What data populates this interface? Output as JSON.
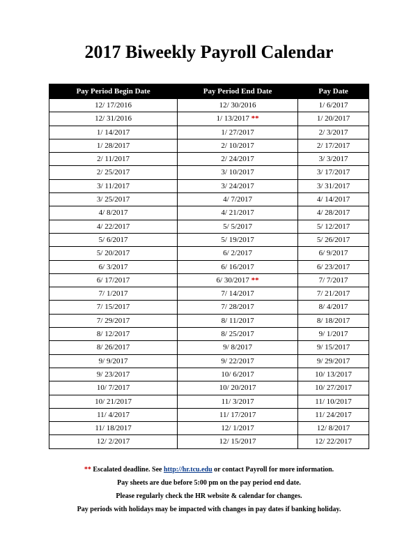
{
  "title": "2017 Biweekly Payroll Calendar",
  "headers": {
    "begin": "Pay Period Begin Date",
    "end": "Pay Period End Date",
    "pay": "Pay Date"
  },
  "rows": [
    {
      "begin": "12/ 17/2016",
      "end": "12/ 30/2016",
      "end_mark": "",
      "pay": "1/ 6/2017"
    },
    {
      "begin": "12/ 31/2016",
      "end": "1/ 13/2017",
      "end_mark": "**",
      "pay": "1/ 20/2017"
    },
    {
      "begin": "1/ 14/2017",
      "end": "1/ 27/2017",
      "end_mark": "",
      "pay": "2/ 3/2017"
    },
    {
      "begin": "1/ 28/2017",
      "end": "2/ 10/2017",
      "end_mark": "",
      "pay": "2/ 17/2017"
    },
    {
      "begin": "2/ 11/2017",
      "end": "2/ 24/2017",
      "end_mark": "",
      "pay": "3/ 3/2017"
    },
    {
      "begin": "2/ 25/2017",
      "end": "3/ 10/2017",
      "end_mark": "",
      "pay": "3/ 17/2017"
    },
    {
      "begin": "3/ 11/2017",
      "end": "3/ 24/2017",
      "end_mark": "",
      "pay": "3/ 31/2017"
    },
    {
      "begin": "3/ 25/2017",
      "end": "4/ 7/2017",
      "end_mark": "",
      "pay": "4/ 14/2017"
    },
    {
      "begin": "4/ 8/2017",
      "end": "4/ 21/2017",
      "end_mark": "",
      "pay": "4/ 28/2017"
    },
    {
      "begin": "4/ 22/2017",
      "end": "5/ 5/2017",
      "end_mark": "",
      "pay": "5/ 12/2017"
    },
    {
      "begin": "5/ 6/2017",
      "end": "5/ 19/2017",
      "end_mark": "",
      "pay": "5/ 26/2017"
    },
    {
      "begin": "5/ 20/2017",
      "end": "6/ 2/2017",
      "end_mark": "",
      "pay": "6/ 9/2017"
    },
    {
      "begin": "6/ 3/2017",
      "end": "6/ 16/2017",
      "end_mark": "",
      "pay": "6/ 23/2017"
    },
    {
      "begin": "6/ 17/2017",
      "end": "6/ 30/2017",
      "end_mark": "**",
      "pay": "7/ 7/2017"
    },
    {
      "begin": "7/ 1/2017",
      "end": "7/ 14/2017",
      "end_mark": "",
      "pay": "7/ 21/2017"
    },
    {
      "begin": "7/ 15/2017",
      "end": "7/ 28/2017",
      "end_mark": "",
      "pay": "8/ 4/2017"
    },
    {
      "begin": "7/ 29/2017",
      "end": "8/ 11/2017",
      "end_mark": "",
      "pay": "8/ 18/2017"
    },
    {
      "begin": "8/ 12/2017",
      "end": "8/ 25/2017",
      "end_mark": "",
      "pay": "9/ 1/2017"
    },
    {
      "begin": "8/ 26/2017",
      "end": "9/ 8/2017",
      "end_mark": "",
      "pay": "9/ 15/2017"
    },
    {
      "begin": "9/ 9/2017",
      "end": "9/ 22/2017",
      "end_mark": "",
      "pay": "9/ 29/2017"
    },
    {
      "begin": "9/ 23/2017",
      "end": "10/ 6/2017",
      "end_mark": "",
      "pay": "10/ 13/2017"
    },
    {
      "begin": "10/ 7/2017",
      "end": "10/ 20/2017",
      "end_mark": "",
      "pay": "10/ 27/2017"
    },
    {
      "begin": "10/ 21/2017",
      "end": "11/ 3/2017",
      "end_mark": "",
      "pay": "11/ 10/2017"
    },
    {
      "begin": "11/ 4/2017",
      "end": "11/ 17/2017",
      "end_mark": "",
      "pay": "11/ 24/2017"
    },
    {
      "begin": "11/ 18/2017",
      "end": "12/ 1/2017",
      "end_mark": "",
      "pay": "12/ 8/2017"
    },
    {
      "begin": "12/ 2/2017",
      "end": "12/ 15/2017",
      "end_mark": "",
      "pay": "12/ 22/2017"
    }
  ],
  "foot": {
    "stars": "**",
    "line1a": " Escalated deadline. See ",
    "link": "http://hr.tcu.edu",
    "line1b": " or contact Payroll for more information.",
    "line2": "Pay sheets are due before 5:00 pm on the pay period end date.",
    "line3": "Please regularly check the HR website & calendar for changes.",
    "line4": "Pay periods with holidays may be impacted with changes in pay dates if banking holiday."
  }
}
